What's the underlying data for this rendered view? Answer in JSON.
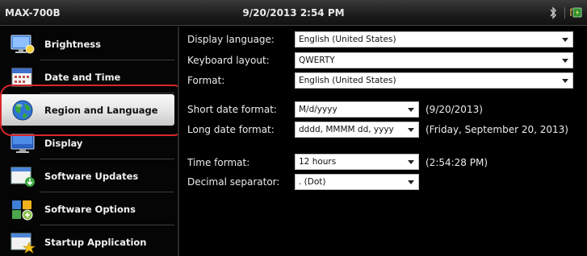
{
  "window": {
    "device_name": "MAX-700B",
    "datetime": "9/20/2013 2:54 PM",
    "status_icons": [
      "bluetooth-icon",
      "battery-charging-icon"
    ]
  },
  "sidebar": {
    "items": [
      {
        "label": "Brightness",
        "icon": "brightness-icon",
        "selected": false
      },
      {
        "label": "Date and Time",
        "icon": "calendar-icon",
        "selected": false
      },
      {
        "label": "Region and Language",
        "icon": "globe-icon",
        "selected": true
      },
      {
        "label": "Display",
        "icon": "display-icon",
        "selected": false
      },
      {
        "label": "Software Updates",
        "icon": "software-updates-icon",
        "selected": false
      },
      {
        "label": "Software Options",
        "icon": "software-options-icon",
        "selected": false
      },
      {
        "label": "Startup Application",
        "icon": "startup-application-icon",
        "selected": false
      }
    ]
  },
  "settings": {
    "display_language": {
      "label": "Display language:",
      "value": "English (United States)"
    },
    "keyboard_layout": {
      "label": "Keyboard layout:",
      "value": "QWERTY"
    },
    "format": {
      "label": "Format:",
      "value": "English (United States)"
    },
    "short_date_format": {
      "label": "Short date format:",
      "value": "M/d/yyyy",
      "example": "(9/20/2013)"
    },
    "long_date_format": {
      "label": "Long date format:",
      "value": "dddd, MMMM dd, yyyy",
      "example": "(Friday, September 20, 2013)"
    },
    "time_format": {
      "label": "Time format:",
      "value": "12 hours",
      "example": "(2:54:28 PM)"
    },
    "decimal_separator": {
      "label": "Decimal separator:",
      "value": ". (Dot)"
    }
  },
  "colors": {
    "highlight_ring": "#d9262c",
    "selected_item_bg": "#e4e4e4",
    "background": "#000000"
  }
}
